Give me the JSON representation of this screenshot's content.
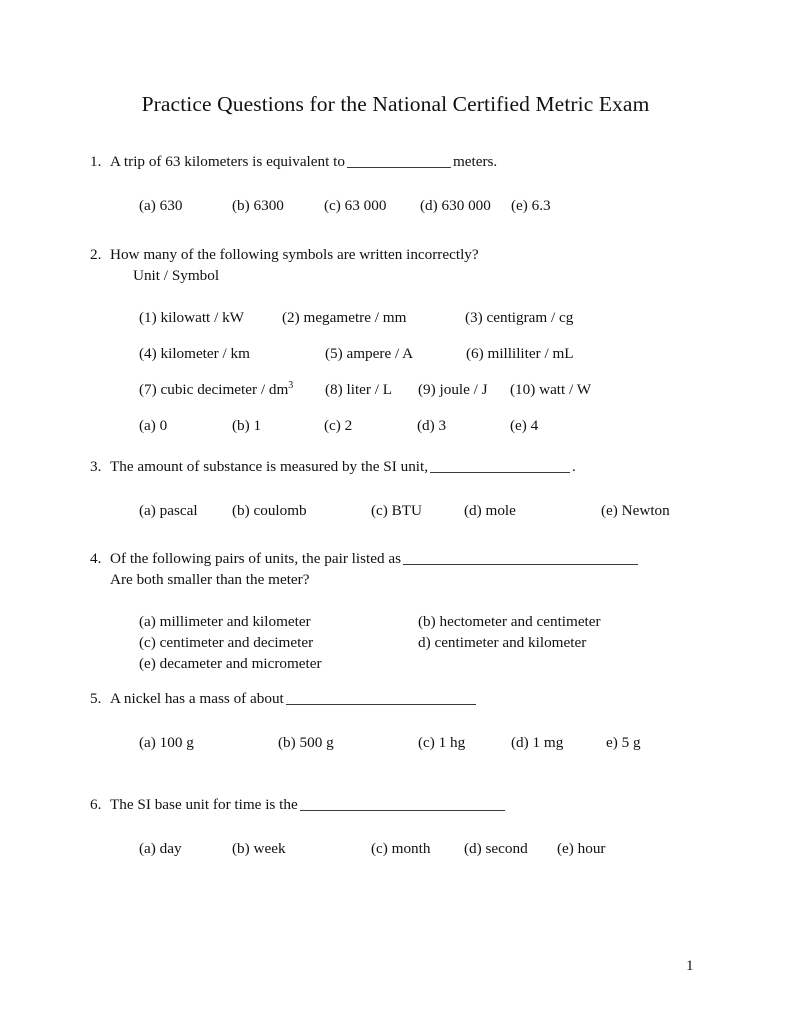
{
  "document": {
    "title": "Practice Questions for the National Certified Metric Exam",
    "page_number": "1"
  },
  "questions": [
    {
      "number": "1.",
      "stem_before_blank": "A trip of 63 kilometers is equivalent to",
      "stem_after_blank": "meters.",
      "options": [
        {
          "label": "(a) 630"
        },
        {
          "label": "(b) 6300"
        },
        {
          "label": "(c) 63 000"
        },
        {
          "label": "(d) 630 000"
        },
        {
          "label": "(e) 6.3"
        }
      ]
    },
    {
      "number": "2.",
      "stem": "How many of the following symbols are written incorrectly?",
      "subheading": "Unit / Symbol",
      "symbol_rows": [
        [
          {
            "label": "(1) kilowatt / kW"
          },
          {
            "label": "(2) megametre / mm"
          },
          {
            "label": "(3) centigram / cg"
          }
        ],
        [
          {
            "label": "(4) kilometer / km"
          },
          {
            "label": "(5) ampere / A"
          },
          {
            "label": "(6) milliliter / mL"
          }
        ],
        [
          {
            "label_pre": "(7) cubic decimeter / dm",
            "label_sup": "3"
          },
          {
            "label": "(8) liter / L"
          },
          {
            "label": "(9) joule / J"
          },
          {
            "label": "(10) watt / W"
          }
        ]
      ],
      "options": [
        {
          "label": "(a) 0"
        },
        {
          "label": "(b) 1"
        },
        {
          "label": "(c) 2"
        },
        {
          "label": "(d) 3"
        },
        {
          "label": "(e) 4"
        }
      ]
    },
    {
      "number": "3.",
      "stem_before_blank": "The amount of substance is measured by the SI unit,",
      "stem_after_blank": ".",
      "options": [
        {
          "label": "(a) pascal"
        },
        {
          "label": "(b) coulomb"
        },
        {
          "label": "(c) BTU"
        },
        {
          "label": "(d) mole"
        },
        {
          "label": "(e) Newton"
        }
      ]
    },
    {
      "number": "4.",
      "stem_before_blank": "Of the following pairs of units, the pair listed as",
      "stem_line2": "Are both smaller than the meter?",
      "options": [
        {
          "label": "(a) millimeter and kilometer"
        },
        {
          "label": "(b) hectometer and centimeter"
        },
        {
          "label": "(c) centimeter and decimeter"
        },
        {
          "label": "d) centimeter and kilometer"
        },
        {
          "label": "(e) decameter and micrometer"
        }
      ]
    },
    {
      "number": "5.",
      "stem_before_blank": "A nickel has a mass of about",
      "options": [
        {
          "label": "(a) 100 g"
        },
        {
          "label": "(b) 500 g"
        },
        {
          "label": "(c) 1 hg"
        },
        {
          "label": "(d) 1 mg"
        },
        {
          "label": "e) 5 g"
        }
      ]
    },
    {
      "number": "6.",
      "stem_before_blank": "The SI base unit for time is the",
      "options": [
        {
          "label": "(a) day"
        },
        {
          "label": "(b) week"
        },
        {
          "label": "(c) month"
        },
        {
          "label": "(d) second"
        },
        {
          "label": "(e) hour"
        }
      ]
    }
  ]
}
